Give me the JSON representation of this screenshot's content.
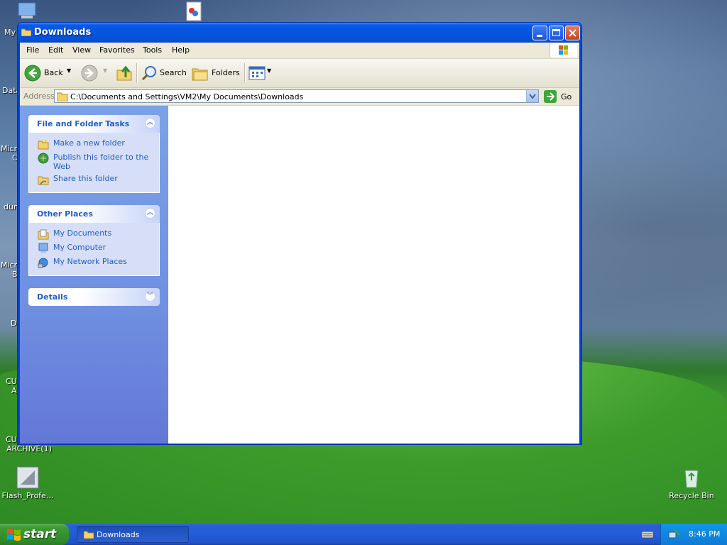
{
  "desktop": {
    "left_labels": [
      "My",
      "Data",
      "Micro",
      "C",
      "dum",
      "Micro",
      "B",
      "D",
      "CU",
      "A",
      "CU",
      "ARCHIVE(1)"
    ],
    "icons": [
      {
        "label": "Flash_Profe..."
      },
      {
        "label": "Recycle Bin"
      }
    ]
  },
  "window": {
    "title": "Downloads",
    "menu": [
      "File",
      "Edit",
      "View",
      "Favorites",
      "Tools",
      "Help"
    ],
    "toolbar": {
      "back": "Back",
      "search": "Search",
      "folders": "Folders"
    },
    "address": {
      "label": "Address",
      "value": "C:\\Documents and Settings\\VM2\\My Documents\\Downloads",
      "go": "Go"
    },
    "panels": [
      {
        "title": "File and Folder Tasks",
        "items": [
          "Make a new folder",
          "Publish this folder to the Web",
          "Share this folder"
        ]
      },
      {
        "title": "Other Places",
        "items": [
          "My Documents",
          "My Computer",
          "My Network Places"
        ]
      },
      {
        "title": "Details",
        "items": []
      }
    ]
  },
  "taskbar": {
    "start": "start",
    "task": "Downloads",
    "clock": "8:46 PM"
  }
}
